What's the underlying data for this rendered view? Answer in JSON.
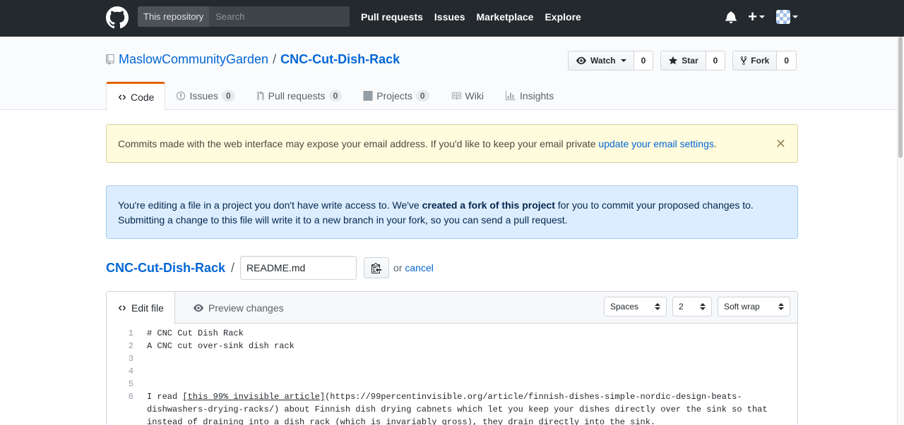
{
  "header": {
    "scope_label": "This repository",
    "search_placeholder": "Search",
    "nav": [
      "Pull requests",
      "Issues",
      "Marketplace",
      "Explore"
    ],
    "plus": "+"
  },
  "repo": {
    "owner": "MaslowCommunityGarden",
    "separator": "/",
    "name": "CNC-Cut-Dish-Rack",
    "watch_label": "Watch",
    "watch_count": "0",
    "star_label": "Star",
    "star_count": "0",
    "fork_label": "Fork",
    "fork_count": "0"
  },
  "tabs": {
    "code": "Code",
    "issues": "Issues",
    "issues_count": "0",
    "pulls": "Pull requests",
    "pulls_count": "0",
    "projects": "Projects",
    "projects_count": "0",
    "wiki": "Wiki",
    "insights": "Insights"
  },
  "flash_warning": {
    "text": "Commits made with the web interface may expose your email address. If you'd like to keep your email private ",
    "link": "update your email settings",
    "period": ".",
    "close": "✕"
  },
  "flash_info": {
    "text_before": "You're editing a file in a project you don't have write access to. We've ",
    "bold": "created a fork of this project",
    "text_after": " for you to commit your proposed changes to. Submitting a change to this file will write it to a new branch in your fork, so you can send a pull request."
  },
  "breadcrumb": {
    "repo": "CNC-Cut-Dish-Rack",
    "separator": "/",
    "filename": "README.md",
    "or_text": "or",
    "cancel": "cancel"
  },
  "editor": {
    "edit_tab": "Edit file",
    "preview_tab": "Preview changes",
    "indent_mode": "Spaces",
    "indent_size": "2",
    "wrap_mode": "Soft wrap",
    "lines": {
      "l1": "# CNC Cut Dish Rack",
      "l2": "A CNC cut over-sink dish rack",
      "l3": "",
      "l4": "",
      "l5": "",
      "l6_pre": "I read ",
      "l6_link": "[this 99% invisible article]",
      "l6_post": "(https://99percentinvisible.org/article/finnish-dishes-simple-nordic-design-beats-dishwashers-drying-racks/) about Finnish dish drying cabnets which let you keep your dishes directly over the sink so that instead of draining into a dish rack (which is invariably gross), they drain directly into the sink."
    },
    "numbers": [
      "1",
      "2",
      "3",
      "4",
      "5",
      "6"
    ]
  },
  "colors": {
    "header_bg": "#24292e",
    "link": "#0366d6",
    "tab_accent": "#e36209",
    "warn_bg": "#fffbdd",
    "info_bg": "#dbedff"
  }
}
